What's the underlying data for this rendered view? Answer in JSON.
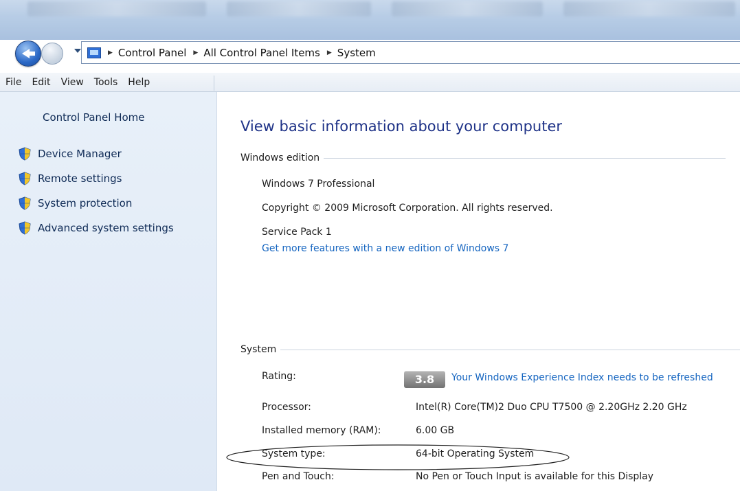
{
  "addressbar": {
    "crumbs": [
      "Control Panel",
      "All Control Panel Items",
      "System"
    ]
  },
  "menu": [
    "File",
    "Edit",
    "View",
    "Tools",
    "Help"
  ],
  "sidebar": {
    "home": "Control Panel Home",
    "tasks": [
      "Device Manager",
      "Remote settings",
      "System protection",
      "Advanced system settings"
    ]
  },
  "main": {
    "title": "View basic information about your computer",
    "edition": {
      "heading": "Windows edition",
      "name": "Windows 7 Professional",
      "copyright": "Copyright © 2009 Microsoft Corporation.  All rights reserved.",
      "service_pack": "Service Pack 1",
      "upgrade_link": "Get more features with a new edition of Windows 7"
    },
    "system": {
      "heading": "System",
      "rating_label": "Rating:",
      "rating_score": "3.8",
      "rating_link": "Your Windows Experience Index needs to be refreshed",
      "rows": [
        {
          "label": "Processor:",
          "value": "Intel(R) Core(TM)2 Duo CPU     T7500  @ 2.20GHz   2.20 GHz"
        },
        {
          "label": "Installed memory (RAM):",
          "value": "6.00 GB"
        },
        {
          "label": "System type:",
          "value": "64-bit Operating System"
        },
        {
          "label": "Pen and Touch:",
          "value": "No Pen or Touch Input is available for this Display"
        }
      ]
    }
  },
  "colors": {
    "title_blue": "#1e3287",
    "link_blue": "#1565c0",
    "sidebar_bg": "#e8f0f9"
  }
}
